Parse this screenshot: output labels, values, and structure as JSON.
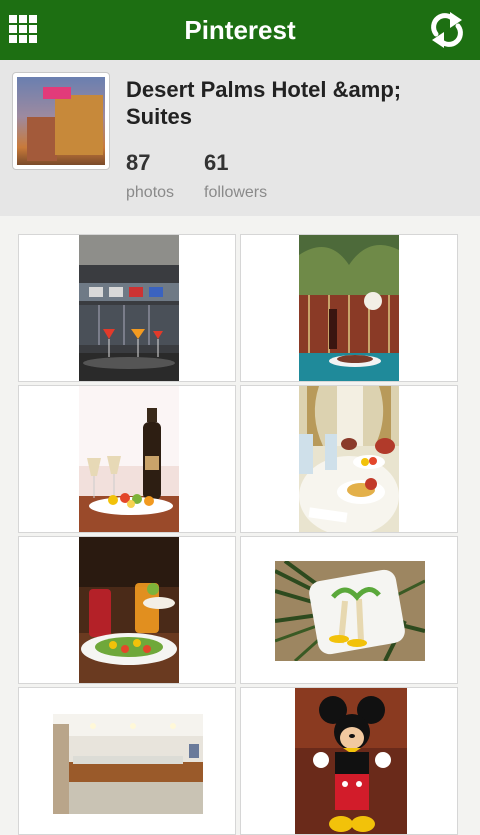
{
  "app": {
    "title": "Pinterest",
    "brand_color": "#1d6f12",
    "menu_icon": "grid-icon",
    "refresh_icon": "refresh-icon"
  },
  "profile": {
    "name": "Desert Palms Hotel &amp; Suites",
    "photos_count": "87",
    "photos_label": "photos",
    "followers_count": "61",
    "followers_label": "followers"
  },
  "photos": [
    {
      "subject": "cocktails bar"
    },
    {
      "subject": "wine table poolside"
    },
    {
      "subject": "champagne fruit plate"
    },
    {
      "subject": "breakfast table"
    },
    {
      "subject": "drinks and salad"
    },
    {
      "subject": "palm-shaped fruit plate"
    },
    {
      "subject": "buffet room"
    },
    {
      "subject": "mickey mouse"
    }
  ]
}
